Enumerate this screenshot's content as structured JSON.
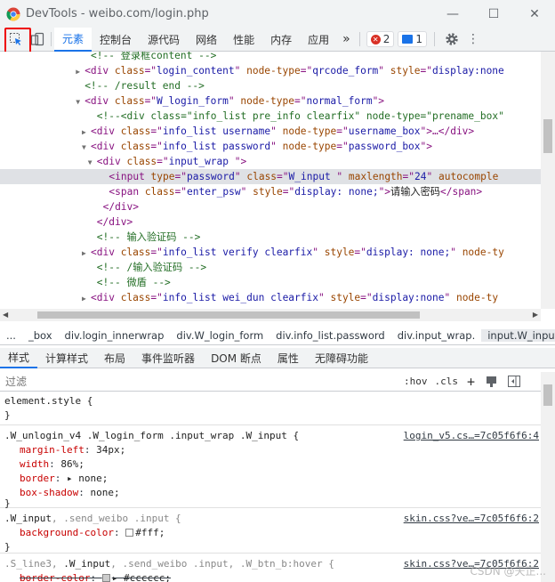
{
  "window": {
    "title": "DevTools - weibo.com/login.php",
    "minimize": "—",
    "maximize": "☐",
    "close": "✕"
  },
  "toolbar": {
    "tabs": [
      "元素",
      "控制台",
      "源代码",
      "网络",
      "性能",
      "内存",
      "应用"
    ],
    "more": "»",
    "errors": "2",
    "messages": "1"
  },
  "dom_lines": [
    {
      "indent": 15,
      "tri": "",
      "html": [
        [
          "cm",
          "<!-- 登录框content -->"
        ]
      ]
    },
    {
      "indent": 14,
      "tri": "▶",
      "html": [
        [
          "tag",
          "<div "
        ],
        [
          "an",
          "class"
        ],
        [
          "tag",
          "=\""
        ],
        [
          "av",
          "login_content"
        ],
        [
          "tag",
          "\" "
        ],
        [
          "an",
          "node-type"
        ],
        [
          "tag",
          "=\""
        ],
        [
          "av",
          "qrcode_form"
        ],
        [
          "tag",
          "\" "
        ],
        [
          "an",
          "style"
        ],
        [
          "tag",
          "=\""
        ],
        [
          "av",
          "display:none"
        ]
      ]
    },
    {
      "indent": 14,
      "tri": "",
      "html": [
        [
          "cm",
          "<!-- /result end -->"
        ]
      ]
    },
    {
      "indent": 14,
      "tri": "▼",
      "html": [
        [
          "tag",
          "<div "
        ],
        [
          "an",
          "class"
        ],
        [
          "tag",
          "=\""
        ],
        [
          "av",
          "W_login_form"
        ],
        [
          "tag",
          "\" "
        ],
        [
          "an",
          "node-type"
        ],
        [
          "tag",
          "=\""
        ],
        [
          "av",
          "normal_form"
        ],
        [
          "tag",
          "\">"
        ]
      ]
    },
    {
      "indent": 16,
      "tri": "",
      "html": [
        [
          "cm",
          "<!--<div class=\"info_list pre_info clearfix\" node-type=\"prename_box\""
        ]
      ]
    },
    {
      "indent": 15,
      "tri": "▶",
      "html": [
        [
          "tag",
          "<div "
        ],
        [
          "an",
          "class"
        ],
        [
          "tag",
          "=\""
        ],
        [
          "av",
          "info_list username"
        ],
        [
          "tag",
          "\" "
        ],
        [
          "an",
          "node-type"
        ],
        [
          "tag",
          "=\""
        ],
        [
          "av",
          "username_box"
        ],
        [
          "tag",
          "\">…</div>"
        ]
      ]
    },
    {
      "indent": 15,
      "tri": "▼",
      "html": [
        [
          "tag",
          "<div "
        ],
        [
          "an",
          "class"
        ],
        [
          "tag",
          "=\""
        ],
        [
          "av",
          "info_list password"
        ],
        [
          "tag",
          "\" "
        ],
        [
          "an",
          "node-type"
        ],
        [
          "tag",
          "=\""
        ],
        [
          "av",
          "password_box"
        ],
        [
          "tag",
          "\">"
        ]
      ]
    },
    {
      "indent": 16,
      "tri": "▼",
      "html": [
        [
          "tag",
          "<div "
        ],
        [
          "an",
          "class"
        ],
        [
          "tag",
          "=\""
        ],
        [
          "av",
          "input_wrap "
        ],
        [
          "tag",
          "\">"
        ]
      ]
    },
    {
      "indent": 18,
      "tri": "",
      "sel": true,
      "html": [
        [
          "tag",
          "<input "
        ],
        [
          "an",
          "type"
        ],
        [
          "tag",
          "=\""
        ],
        [
          "av",
          "password"
        ],
        [
          "tag",
          "\" "
        ],
        [
          "an",
          "class"
        ],
        [
          "tag",
          "=\""
        ],
        [
          "av",
          "W_input "
        ],
        [
          "tag",
          "\" "
        ],
        [
          "an",
          "maxlength"
        ],
        [
          "tag",
          "=\""
        ],
        [
          "av",
          "24"
        ],
        [
          "tag",
          "\" "
        ],
        [
          "an",
          "autocomple"
        ]
      ]
    },
    {
      "indent": 18,
      "tri": "",
      "html": [
        [
          "tag",
          "<span "
        ],
        [
          "an",
          "class"
        ],
        [
          "tag",
          "=\""
        ],
        [
          "av",
          "enter_psw"
        ],
        [
          "tag",
          "\" "
        ],
        [
          "an",
          "style"
        ],
        [
          "tag",
          "=\""
        ],
        [
          "av",
          "display: none;"
        ],
        [
          "tag",
          "\">"
        ],
        [
          "tx",
          "请输入密码"
        ],
        [
          "tag",
          "</span>"
        ]
      ]
    },
    {
      "indent": 17,
      "tri": "",
      "html": [
        [
          "tag",
          "</div>"
        ]
      ]
    },
    {
      "indent": 16,
      "tri": "",
      "html": [
        [
          "tag",
          "</div>"
        ]
      ]
    },
    {
      "indent": 16,
      "tri": "",
      "html": [
        [
          "cm",
          "<!-- 输入验证码 -->"
        ]
      ]
    },
    {
      "indent": 15,
      "tri": "▶",
      "html": [
        [
          "tag",
          "<div "
        ],
        [
          "an",
          "class"
        ],
        [
          "tag",
          "=\""
        ],
        [
          "av",
          "info_list verify clearfix"
        ],
        [
          "tag",
          "\" "
        ],
        [
          "an",
          "style"
        ],
        [
          "tag",
          "=\""
        ],
        [
          "av",
          "display: none;"
        ],
        [
          "tag",
          "\" "
        ],
        [
          "an",
          "node-ty"
        ]
      ]
    },
    {
      "indent": 16,
      "tri": "",
      "html": [
        [
          "cm",
          "<!-- /输入验证码 -->"
        ]
      ]
    },
    {
      "indent": 16,
      "tri": "",
      "html": [
        [
          "cm",
          "<!-- 微盾 -->"
        ]
      ]
    },
    {
      "indent": 15,
      "tri": "▶",
      "html": [
        [
          "tag",
          "<div "
        ],
        [
          "an",
          "class"
        ],
        [
          "tag",
          "=\""
        ],
        [
          "av",
          "info_list wei_dun clearfix"
        ],
        [
          "tag",
          "\" "
        ],
        [
          "an",
          "style"
        ],
        [
          "tag",
          "=\""
        ],
        [
          "av",
          "display:none"
        ],
        [
          "tag",
          "\" "
        ],
        [
          "an",
          "node-ty"
        ]
      ]
    }
  ],
  "breadcrumbs": {
    "dots": "...",
    "items": [
      "_box",
      "div.login_innerwrap",
      "div.W_login_form",
      "div.info_list.password",
      "div.input_wrap.",
      "input.W_input."
    ]
  },
  "subtabs": [
    "样式",
    "计算样式",
    "布局",
    "事件监听器",
    "DOM 断点",
    "属性",
    "无障碍功能"
  ],
  "filter": {
    "placeholder": "过滤",
    "hov": ":hov",
    "cls": ".cls",
    "add": "+"
  },
  "styles": {
    "element_style": {
      "selector": "element.style {",
      "close": "}"
    },
    "rule1": {
      "selector": ".W_unlogin_v4 .W_login_form .input_wrap .W_input {",
      "source": "login_v5.cs…=7c05f6f6:4",
      "props": [
        {
          "name": "margin-left",
          "value": "34px;"
        },
        {
          "name": "width",
          "value": "86%;"
        },
        {
          "name": "border",
          "value": "▸ none;"
        },
        {
          "name": "box-shadow",
          "value": "none;"
        }
      ],
      "close": "}"
    },
    "rule2": {
      "selector_main": ".W_input",
      "selector_rest": ", .send_weibo .input {",
      "source": "skin.css?ve…=7c05f6f6:2",
      "props": [
        {
          "name": "background-color",
          "value": "#fff;"
        }
      ],
      "swatch": "#ffffff",
      "close": "}"
    },
    "rule3": {
      "selector_pre": ".S_line3, ",
      "selector_main": ".W_input",
      "selector_rest": ", .send_weibo .input, .W_btn_b:hover {",
      "source": "skin.css?ve…=7c05f6f6:2",
      "props": [
        {
          "name": "border-color",
          "value": "▸ #cccccc;"
        }
      ],
      "swatch": "#cccccc"
    }
  },
  "watermark": "CSDN @天正..."
}
